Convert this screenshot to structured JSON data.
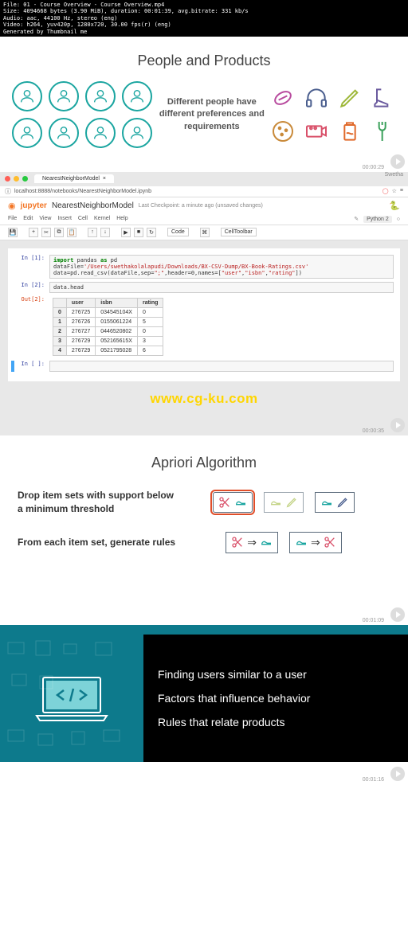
{
  "meta": {
    "line1": "File: 01 - Course Overview - Course Overview.mp4",
    "line2": "Size: 4094668 bytes (3.90 MiB), duration: 00:01:39, avg.bitrate: 331 kb/s",
    "line3": "Audio: aac, 44100 Hz, stereo (eng)",
    "line4": "Video: h264, yuv420p, 1280x720, 30.00 fps(r) (eng)",
    "line5": "Generated by Thumbnail me"
  },
  "section1": {
    "title": "People and Products",
    "caption": "Different people have different preferences and requirements",
    "timestamp": "00:00:29"
  },
  "section2": {
    "tab_title": "NearestNeighborModel",
    "url": "localhost:8888/notebooks/NearestNeighborModel.ipynb",
    "jupyter_label": "jupyter",
    "notebook_name": "NearestNeighborModel",
    "checkpoint": "Last Checkpoint: a minute ago (unsaved changes)",
    "kernel_label": "Python 2",
    "menu": {
      "file": "File",
      "edit": "Edit",
      "view": "View",
      "insert": "Insert",
      "cell": "Cell",
      "kernel": "Kernel",
      "help": "Help"
    },
    "toolbar": {
      "format": "Code",
      "celltoolbar": "CellToolbar"
    },
    "cells": {
      "in1_prompt": "In [1]:",
      "in1_line1_a": "import",
      "in1_line1_b": " pandas ",
      "in1_line1_c": "as",
      "in1_line1_d": " pd",
      "in1_line2_a": "dataFile=",
      "in1_line2_b": "'/Users/swethakolalapudi/Downloads/BX-CSV-Dump/BX-Book-Ratings.csv'",
      "in1_line3_a": "data=pd.read_csv(dataFile,sep=",
      "in1_line3_b": "\";\"",
      "in1_line3_c": ",header=",
      "in1_line3_d": "0",
      "in1_line3_e": ",names=[",
      "in1_line3_f": "\"user\"",
      "in1_line3_g": ",",
      "in1_line3_h": "\"isbn\"",
      "in1_line3_i": ",",
      "in1_line3_j": "\"rating\"",
      "in1_line3_k": "])",
      "in2_prompt": "In [2]:",
      "in2_code": "data.head",
      "out2_prompt": "Out[2]:",
      "in_empty_prompt": "In [ ]:"
    },
    "table": {
      "headers": {
        "idx": "",
        "user": "user",
        "isbn": "isbn",
        "rating": "rating"
      },
      "rows": [
        {
          "idx": "0",
          "user": "276725",
          "isbn": "034545104X",
          "rating": "0"
        },
        {
          "idx": "1",
          "user": "276726",
          "isbn": "0155061224",
          "rating": "5"
        },
        {
          "idx": "2",
          "user": "276727",
          "isbn": "0446520802",
          "rating": "0"
        },
        {
          "idx": "3",
          "user": "276729",
          "isbn": "052165615X",
          "rating": "3"
        },
        {
          "idx": "4",
          "user": "276729",
          "isbn": "0521795028",
          "rating": "6"
        }
      ]
    },
    "watermark": "www.cg-ku.com",
    "timestamp": "00:00:35",
    "user_name": "Swetha"
  },
  "section3": {
    "title": "Apriori Algorithm",
    "text1": "Drop item sets with support below a minimum threshold",
    "text2": "From each item set, generate rules",
    "timestamp": "00:01:09"
  },
  "section4": {
    "line1": "Finding users similar to a user",
    "line2": "Factors that influence behavior",
    "line3": "Rules that relate products",
    "timestamp": "00:01:16"
  }
}
